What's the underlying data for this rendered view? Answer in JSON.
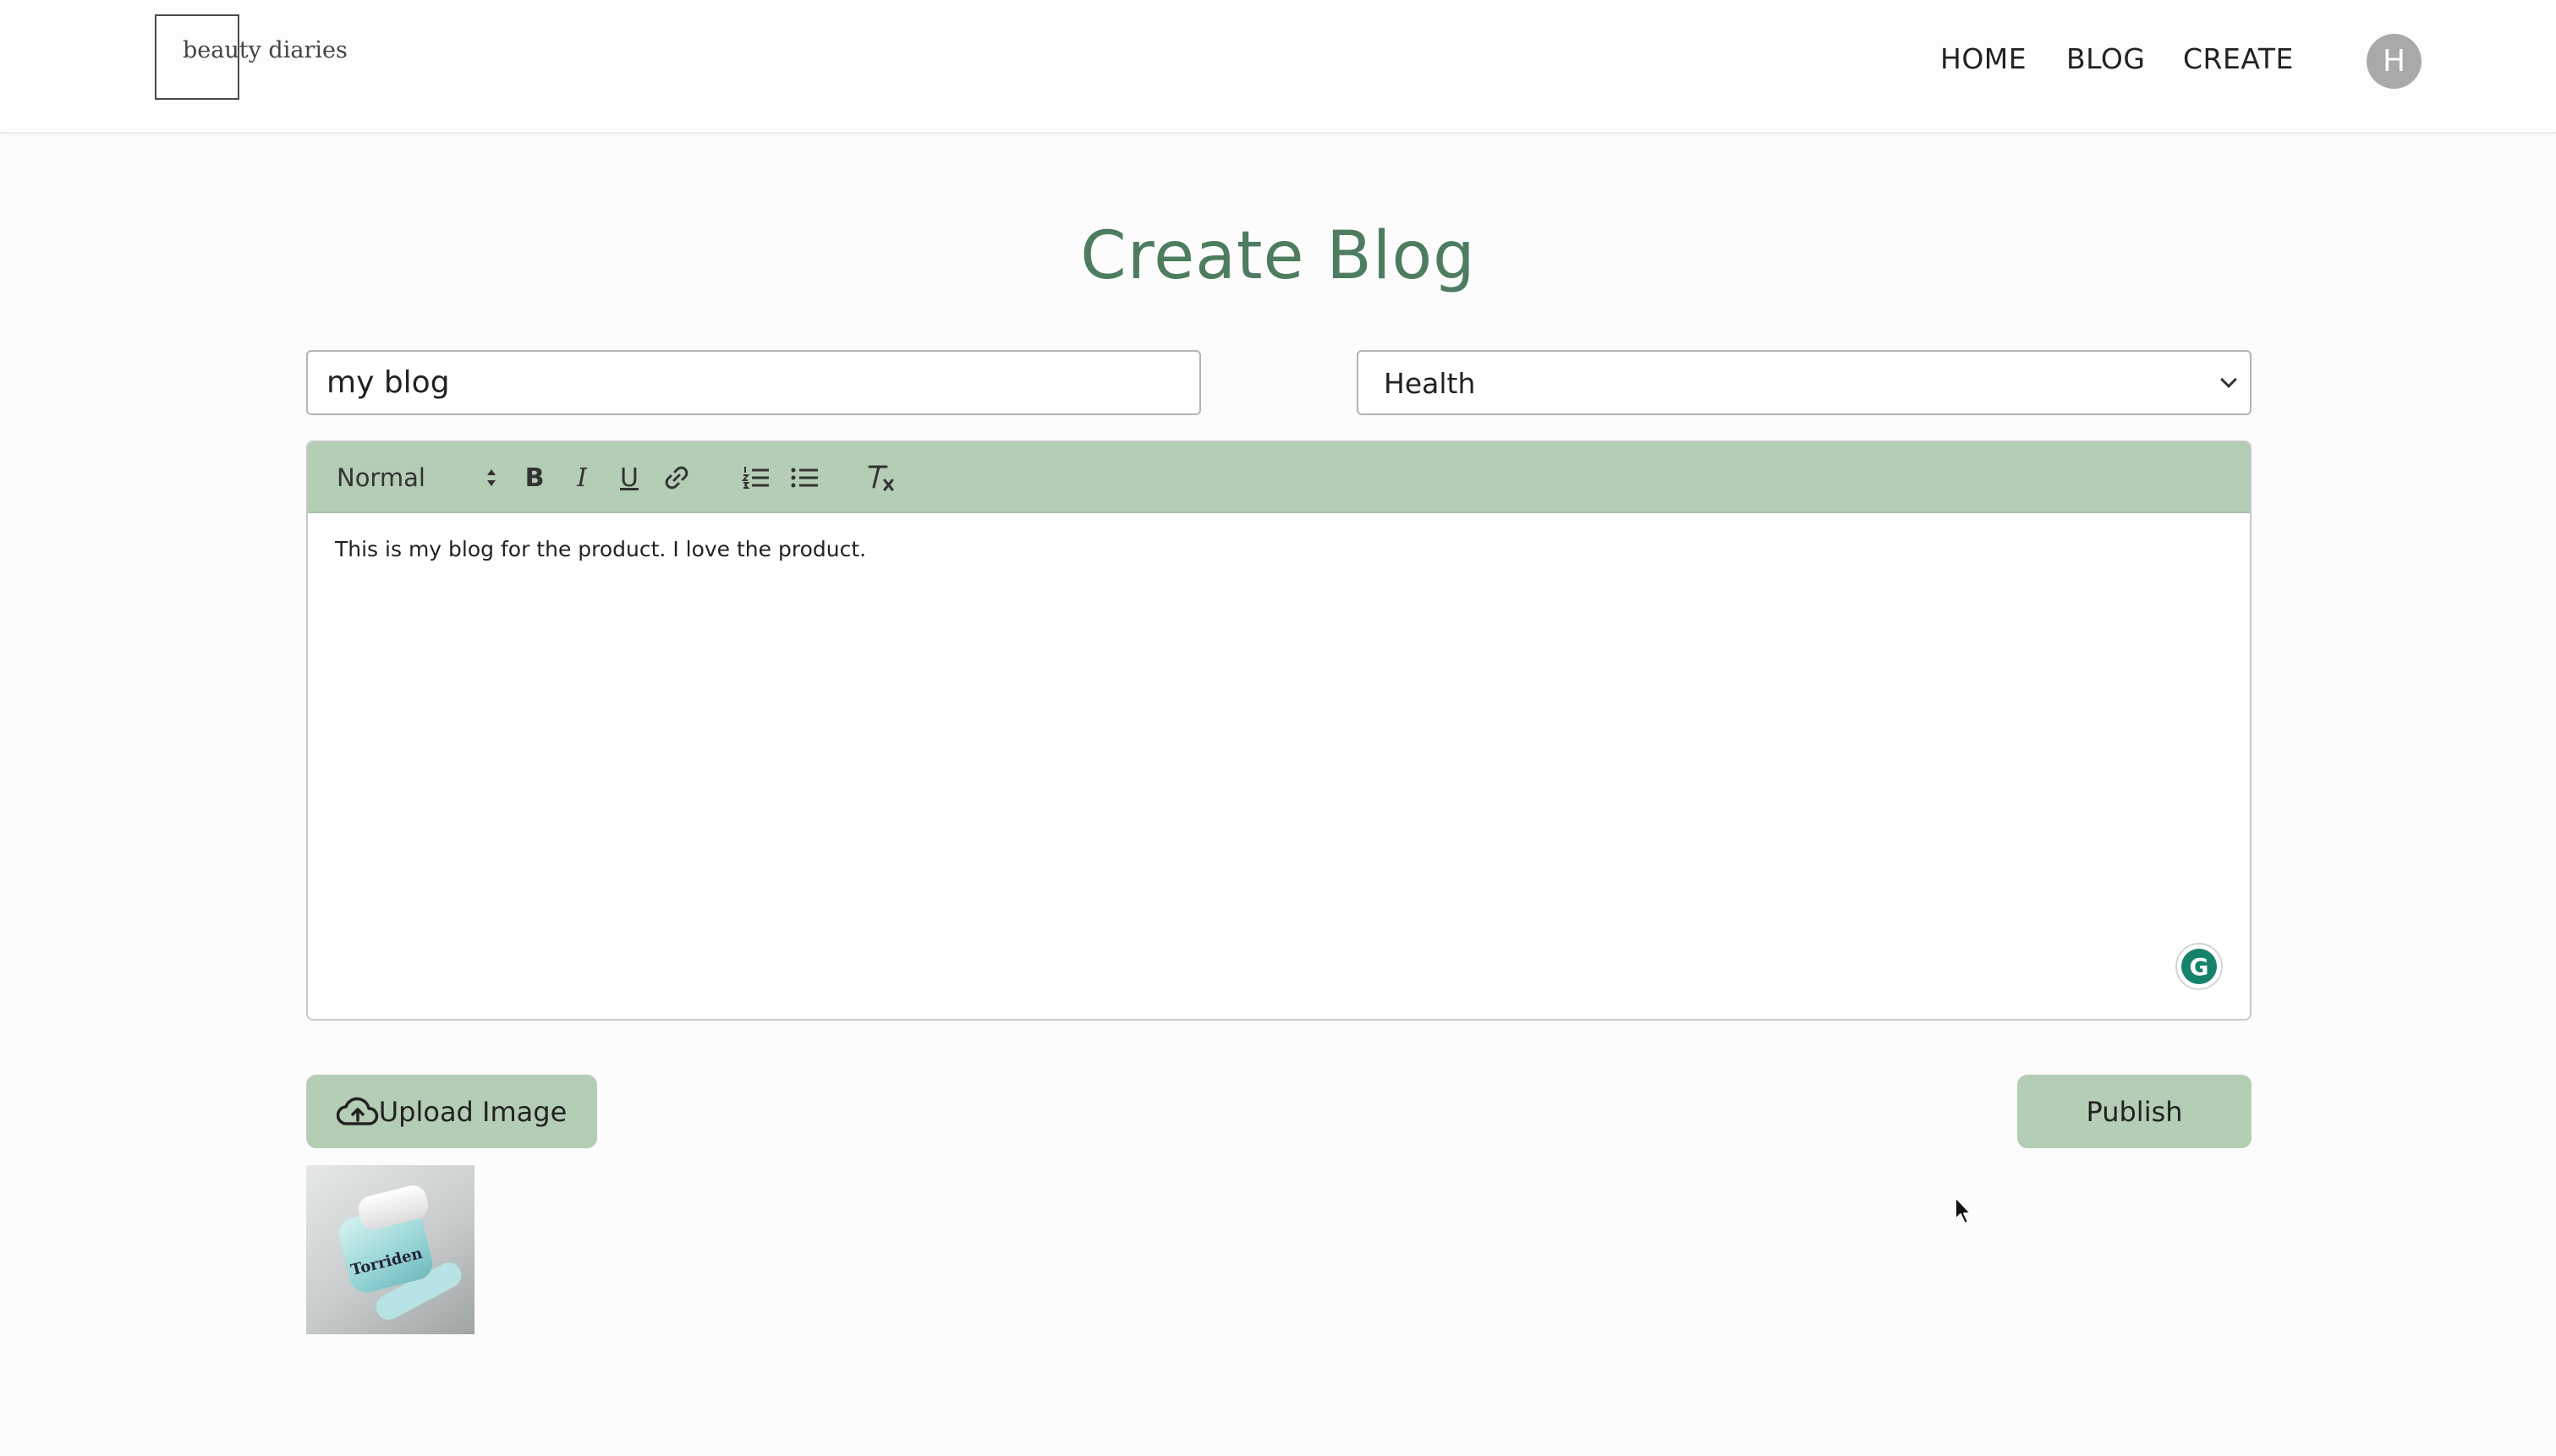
{
  "header": {
    "logo_text": "beauty diaries",
    "nav": {
      "home": "HOME",
      "blog": "BLOG",
      "create": "CREATE"
    },
    "avatar_initial": "H"
  },
  "page": {
    "title": "Create Blog"
  },
  "form": {
    "title_value": "my blog",
    "category_value": "Health"
  },
  "editor": {
    "format_label": "Normal",
    "body_text": "This is my blog for the product. I love the product.",
    "toolbar_icons": [
      "bold-icon",
      "italic-icon",
      "underline-icon",
      "link-icon",
      "ordered-list-icon",
      "bullet-list-icon",
      "clear-format-icon"
    ]
  },
  "actions": {
    "upload_label": "Upload Image",
    "publish_label": "Publish"
  },
  "thumbnail": {
    "label_text": "Torriden"
  },
  "colors": {
    "accent": "#b4cdb5",
    "title": "#4e7c60",
    "grammarly": "#15826c",
    "avatar": "#a9a9a9"
  }
}
